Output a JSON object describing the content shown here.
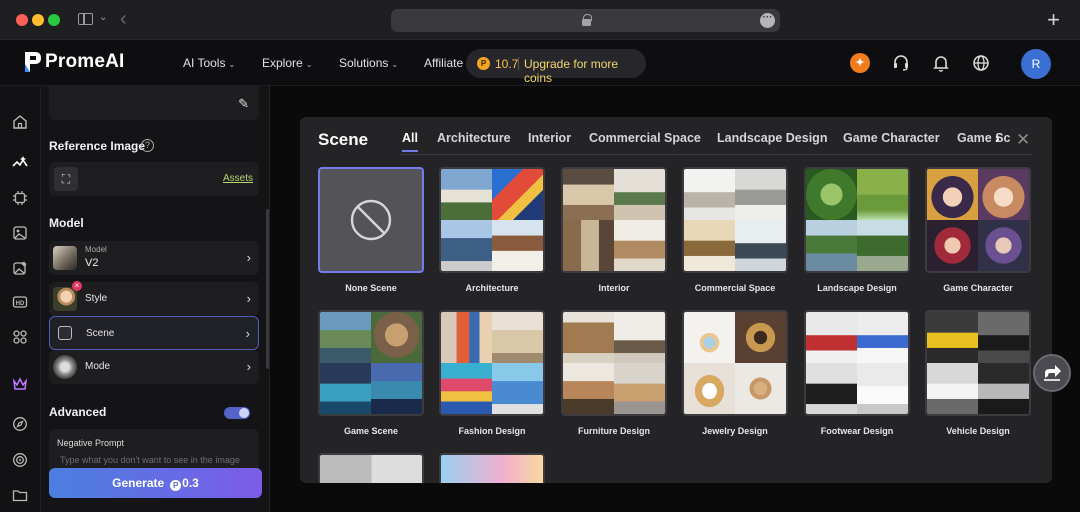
{
  "brand": {
    "name": "PromeAI"
  },
  "topnav": {
    "items": [
      {
        "label": "AI Tools",
        "caret": true
      },
      {
        "label": "Explore",
        "caret": true
      },
      {
        "label": "Solutions",
        "caret": true
      },
      {
        "label": "Affiliate",
        "caret": false
      }
    ],
    "coins": "10.7",
    "upgrade_label": "Upgrade for more coins",
    "avatar_initial": "R"
  },
  "panel": {
    "reference_title": "Reference Image",
    "help_glyph": "?",
    "assets_link": "Assets",
    "model_title": "Model",
    "model_row": {
      "sub": "Model",
      "value": "V2"
    },
    "style_label": "Style",
    "scene_label": "Scene",
    "mode_label": "Mode",
    "advanced_title": "Advanced",
    "advanced_enabled": true,
    "negative_prompt_title": "Negative Prompt",
    "negative_prompt_placeholder": "Type what you don't want to see in the image",
    "generate_label": "Generate",
    "generate_cost": "0.3"
  },
  "modal": {
    "title": "Scene",
    "tabs": [
      "All",
      "Architecture",
      "Interior",
      "Commercial Space",
      "Landscape Design",
      "Game Character",
      "Game Scene"
    ],
    "active_tab": "All",
    "cards": [
      {
        "label": "None Scene",
        "selected": true
      },
      {
        "label": "Architecture"
      },
      {
        "label": "Interior"
      },
      {
        "label": "Commercial Space"
      },
      {
        "label": "Landscape Design"
      },
      {
        "label": "Game Character"
      },
      {
        "label": "Game Scene"
      },
      {
        "label": "Fashion Design"
      },
      {
        "label": "Furniture Design"
      },
      {
        "label": "Jewelry Design"
      },
      {
        "label": "Footwear Design"
      },
      {
        "label": "Vehicle Design"
      }
    ]
  },
  "colors": {
    "accent": "#6d7fe6",
    "coin": "#f5a524",
    "upgrade_text": "#f2d96a",
    "assets_link": "#b5d86a",
    "avatar": "#3b6fd4"
  }
}
